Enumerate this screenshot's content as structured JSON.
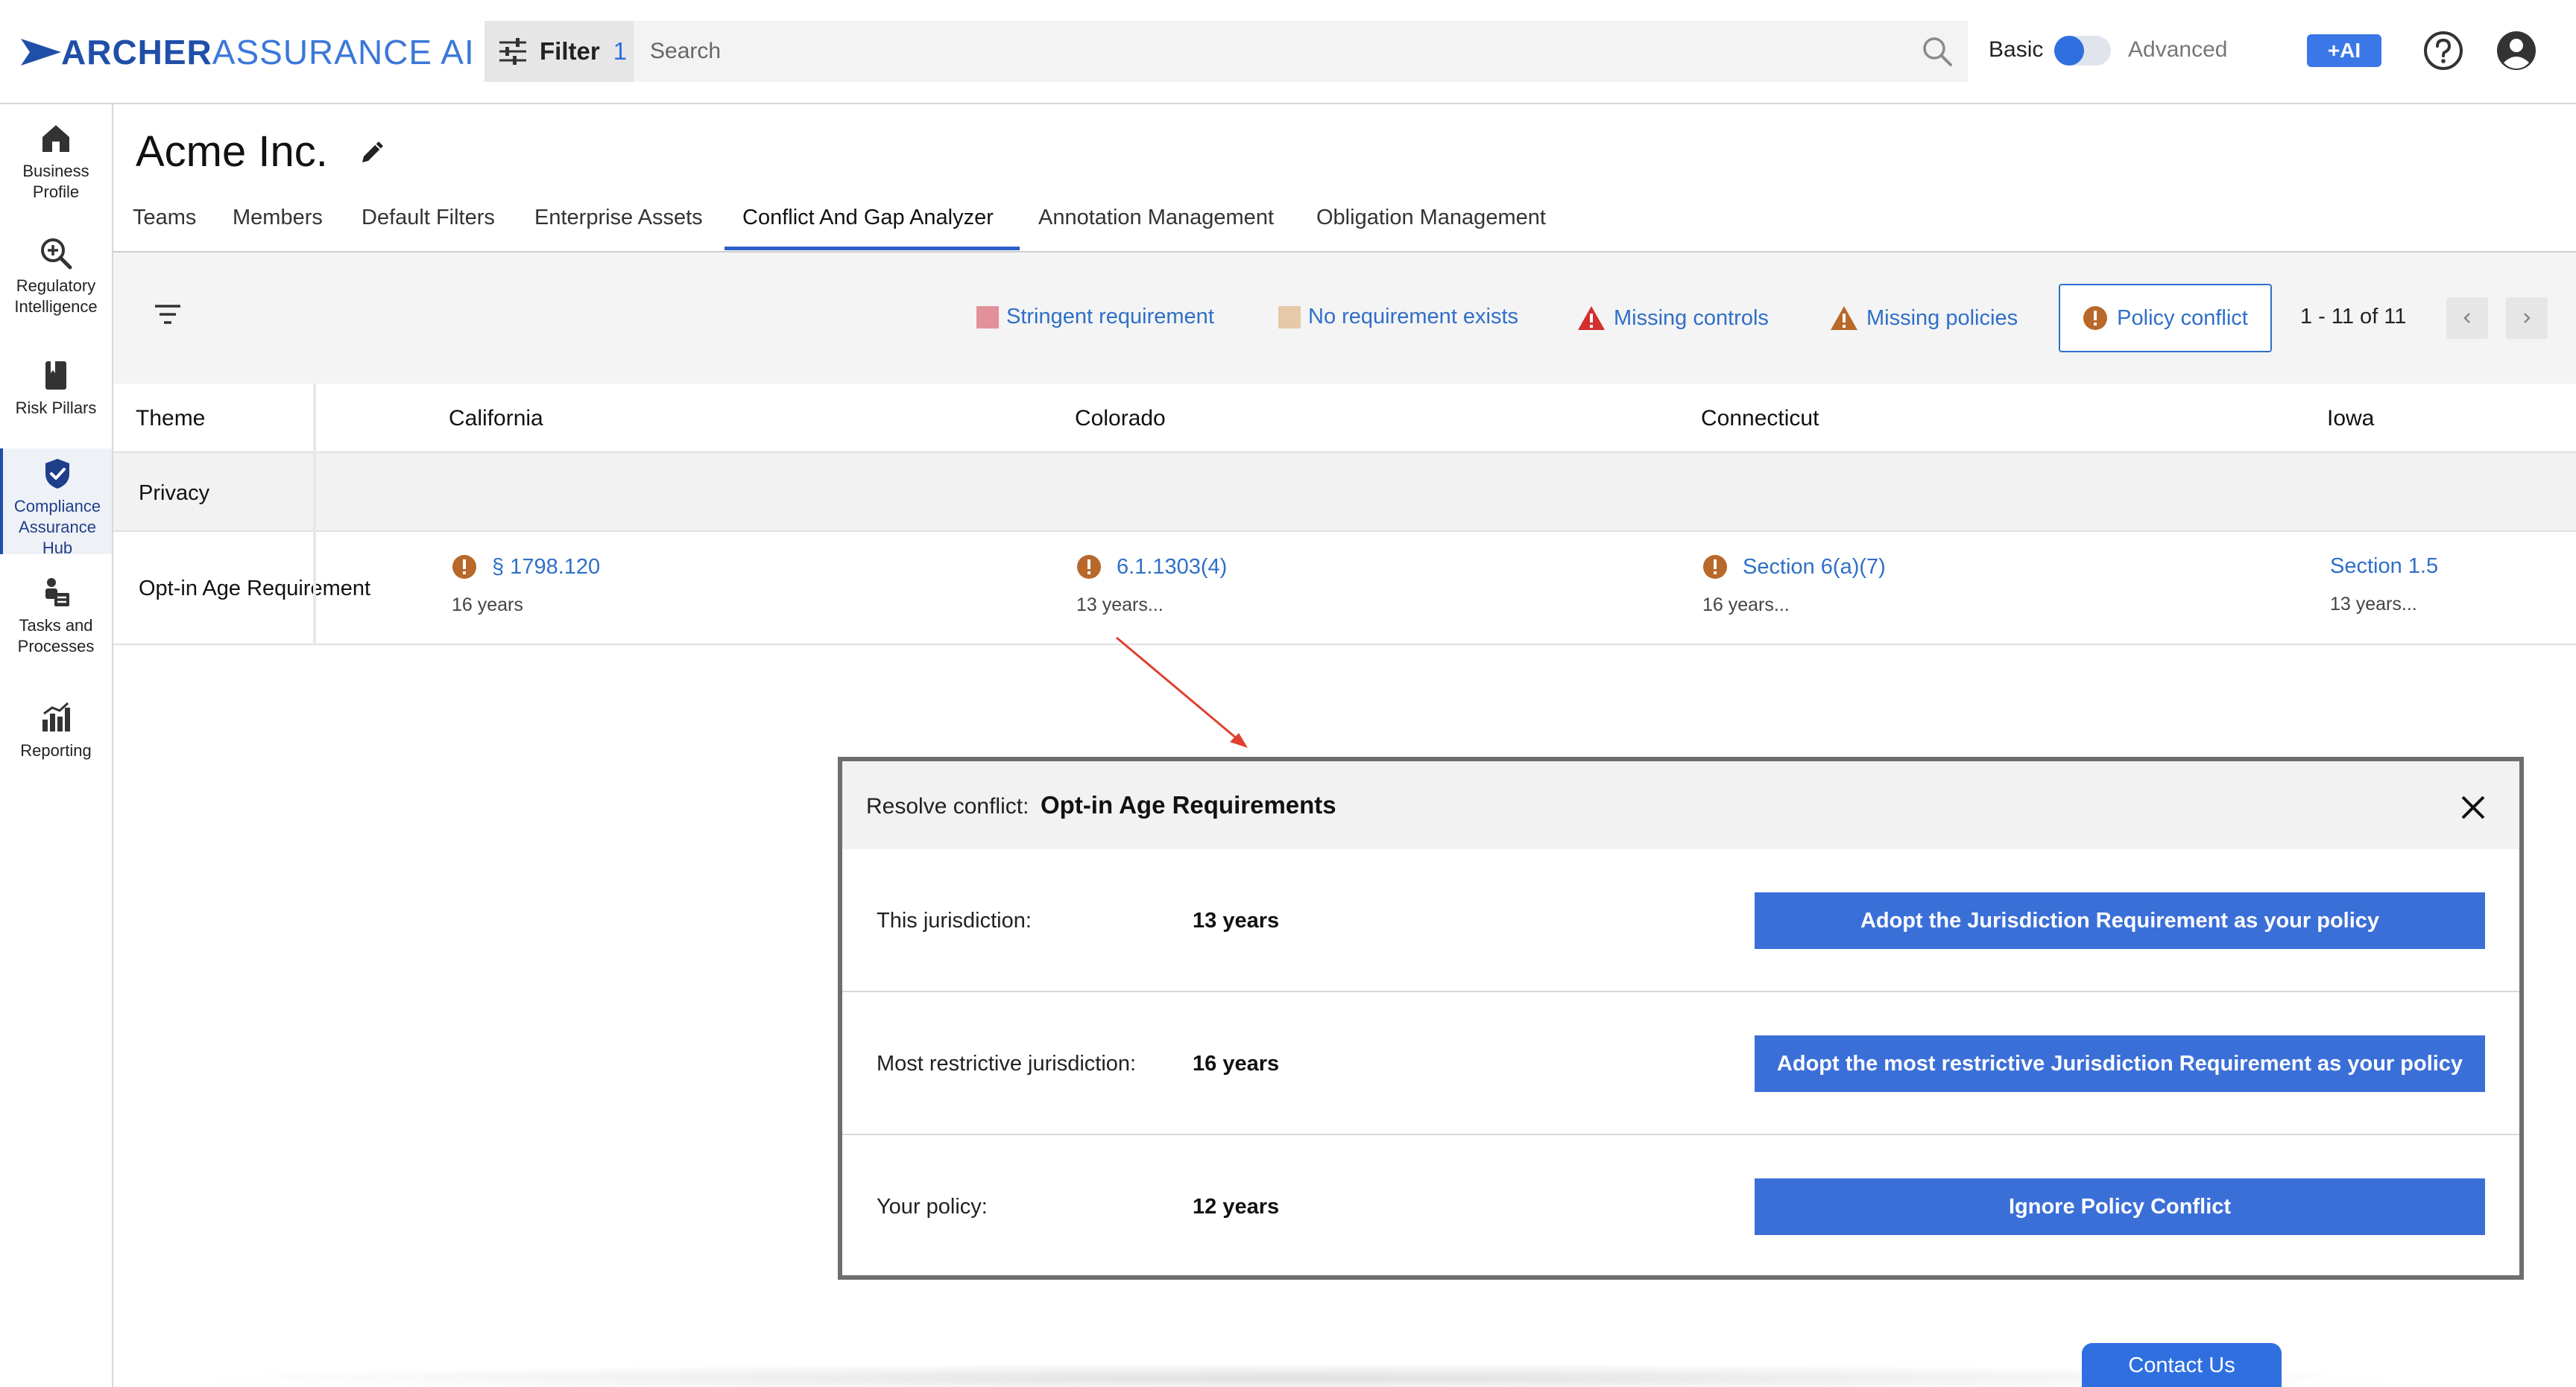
{
  "app": {
    "logo_part1": "ARCHER",
    "logo_part2": "ASSURANCE AI"
  },
  "topbar": {
    "filter_label": "Filter",
    "filter_count": "1",
    "search_placeholder": "Search",
    "mode_basic": "Basic",
    "mode_advanced": "Advanced",
    "ai_label": "+AI"
  },
  "sidebar": {
    "items": [
      {
        "label_line1": "Business",
        "label_line2": "Profile"
      },
      {
        "label_line1": "Regulatory",
        "label_line2": "Intelligence"
      },
      {
        "label_line1": "Risk Pillars",
        "label_line2": ""
      },
      {
        "label_line1": "Compliance",
        "label_line2": "Assurance",
        "label_line3": "Hub"
      },
      {
        "label_line1": "Tasks and",
        "label_line2": "Processes"
      },
      {
        "label_line1": "Reporting",
        "label_line2": ""
      }
    ]
  },
  "page": {
    "title": "Acme Inc."
  },
  "tabs": [
    {
      "label": "Teams"
    },
    {
      "label": "Members"
    },
    {
      "label": "Default Filters"
    },
    {
      "label": "Enterprise Assets"
    },
    {
      "label": "Conflict And Gap Analyzer"
    },
    {
      "label": "Annotation Management"
    },
    {
      "label": "Obligation Management"
    }
  ],
  "legend": {
    "stringent": "Stringent requirement",
    "no_requirement": "No requirement exists",
    "missing_controls": "Missing controls",
    "missing_policies": "Missing policies",
    "policy_conflict": "Policy conflict",
    "stringent_color": "#e2919a",
    "no_requirement_color": "#e6c9a8",
    "missing_controls_color": "#d32f2f",
    "missing_policies_color": "#b8682a",
    "policy_conflict_color": "#b8682a"
  },
  "pager": {
    "text": "1 - 11 of 11"
  },
  "table": {
    "headers": [
      "Theme",
      "California",
      "Colorado",
      "Connecticut",
      "Iowa"
    ],
    "group": "Privacy",
    "row_label": "Opt-in Age Requirement",
    "cells": [
      {
        "link": "§ 1798.120",
        "sub": "16 years"
      },
      {
        "link": "6.1.1303(4)",
        "sub": "13 years..."
      },
      {
        "link": "Section 6(a)(7)",
        "sub": "16 years..."
      },
      {
        "link": "Section 1.5",
        "sub": "13 years..."
      }
    ]
  },
  "modal": {
    "title_prefix": "Resolve conflict:",
    "title": "Opt-in Age Requirements",
    "rows": [
      {
        "label": "This jurisdiction:",
        "value": "13 years",
        "button": "Adopt the Jurisdiction Requirement as your policy"
      },
      {
        "label": "Most restrictive jurisdiction:",
        "value": "16 years",
        "button": "Adopt the most restrictive Jurisdiction Requirement as your policy"
      },
      {
        "label": "Your policy:",
        "value": "12 years",
        "button": "Ignore Policy Conflict"
      }
    ]
  },
  "footer": {
    "contact": "Contact Us"
  }
}
